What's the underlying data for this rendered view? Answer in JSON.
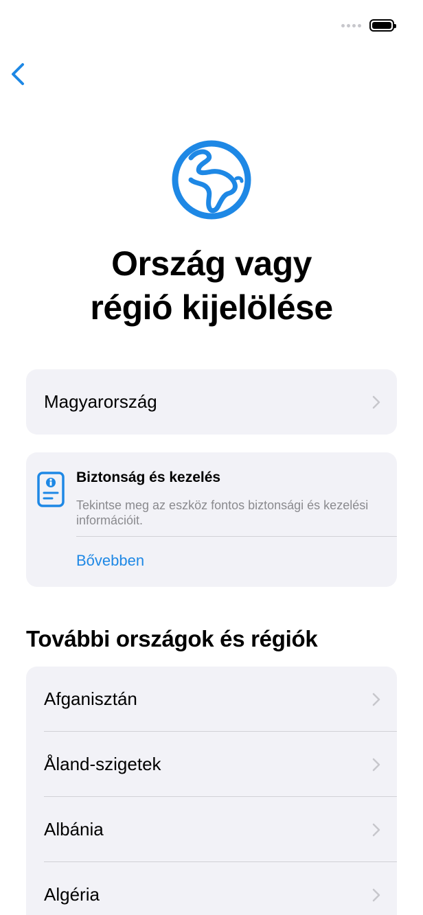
{
  "status_bar": {
    "battery_level": 1.0
  },
  "header": {
    "back_icon": "chevron-left-icon",
    "globe_icon": "globe-icon",
    "title": "Ország vagy\nrégió kijelölése"
  },
  "selected_region": {
    "label": "Magyarország"
  },
  "safety_info": {
    "icon": "info-document-icon",
    "title": "Biztonság és kezelés",
    "description": "Tekintse meg az eszköz fontos biztonsági és kezelési információit.",
    "link_label": "Bővebben"
  },
  "more_regions": {
    "header": "További országok és régiók",
    "items": [
      {
        "label": "Afganisztán"
      },
      {
        "label": "Åland-szigetek"
      },
      {
        "label": "Albánia"
      },
      {
        "label": "Algéria"
      }
    ]
  },
  "colors": {
    "accent": "#1e88e5",
    "card_background": "#f2f2f7",
    "secondary_text": "#8a8a8e",
    "chevron": "#c7c7cc"
  }
}
